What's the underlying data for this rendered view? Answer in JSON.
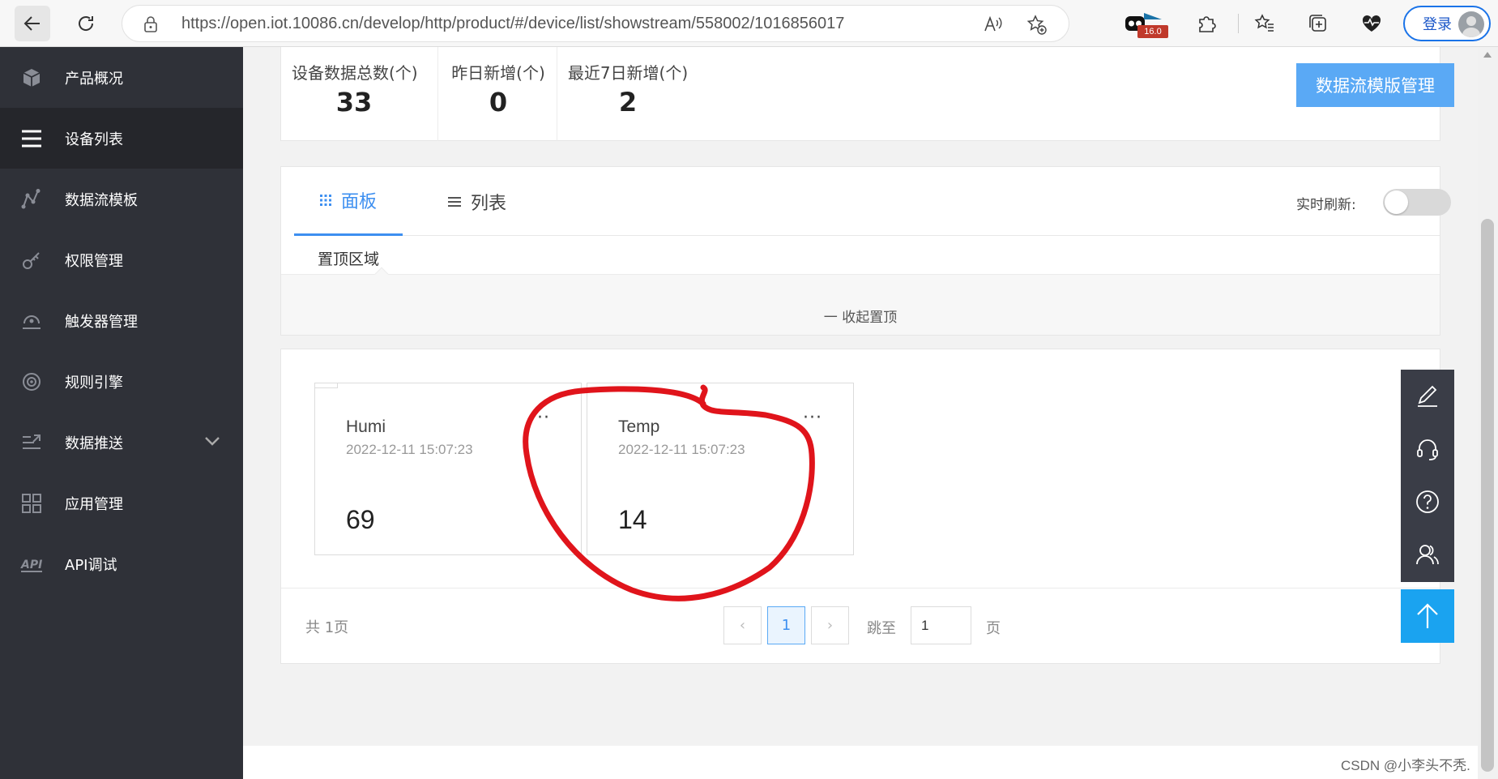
{
  "browser": {
    "url": "https://open.iot.10086.cn/develop/http/product/#/device/list/showstream/558002/1016856017",
    "extension_badge": "16.0",
    "login_label": "登录"
  },
  "sidebar": {
    "items": [
      {
        "label": "产品概况",
        "icon": "cube-icon"
      },
      {
        "label": "设备列表",
        "icon": "list-icon",
        "active": true
      },
      {
        "label": "数据流模板",
        "icon": "stream-icon"
      },
      {
        "label": "权限管理",
        "icon": "key-icon"
      },
      {
        "label": "触发器管理",
        "icon": "trigger-icon"
      },
      {
        "label": "规则引擎",
        "icon": "target-icon"
      },
      {
        "label": "数据推送",
        "icon": "push-icon",
        "expandable": true
      },
      {
        "label": "应用管理",
        "icon": "grid-icon"
      },
      {
        "label": "API调试",
        "icon": "api-icon"
      }
    ]
  },
  "stats": {
    "total_label": "设备数据总数(个)",
    "total_value": "33",
    "yesterday_label": "昨日新增(个)",
    "yesterday_value": "0",
    "week_label": "最近7日新增(个)",
    "week_value": "2",
    "template_button": "数据流模版管理"
  },
  "view": {
    "tab_panel": "面板",
    "tab_list": "列表",
    "refresh_label": "实时刷新:",
    "refresh_on": false,
    "pinned_label": "置顶区域",
    "collapse_label": "一 收起置顶"
  },
  "cards": [
    {
      "name": "Humi",
      "time": "2022-12-11 15:07:23",
      "value": "69",
      "more": "···"
    },
    {
      "name": "Temp",
      "time": "2022-12-11 15:07:23",
      "value": "14",
      "more": "···"
    }
  ],
  "pagination": {
    "total_text": "共 1页",
    "prev": "‹",
    "current": "1",
    "next": "›",
    "jump_label": "跳至",
    "jump_value": "1",
    "page_suffix": "页"
  },
  "watermark": "CSDN @小李头不秃.",
  "colors": {
    "accent": "#3d8ff0",
    "button": "#5aa9f5",
    "sidebar_bg": "#2f3138",
    "annotation": "#e0141b",
    "to_top": "#1aa3f0"
  }
}
